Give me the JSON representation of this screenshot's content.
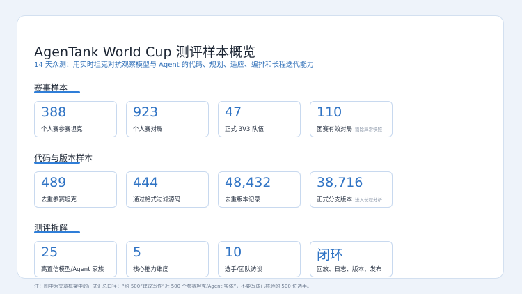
{
  "title": "AgenTank World Cup 测评样本概览",
  "subtitle": "14 天众测：用实时坦克对抗观察模型与 Agent 的代码、规划、适应、编排和长程迭代能力",
  "sections": [
    {
      "heading": "赛事样本",
      "stats": [
        {
          "value": "388",
          "label": "个人赛参赛坦克",
          "note": ""
        },
        {
          "value": "923",
          "label": "个人赛对局",
          "note": ""
        },
        {
          "value": "47",
          "label": "正式 3V3 队伍",
          "note": ""
        },
        {
          "value": "110",
          "label": "团赛有效对局",
          "note": "剔除异常快照"
        }
      ]
    },
    {
      "heading": "代码与版本样本",
      "stats": [
        {
          "value": "489",
          "label": "去重参赛坦克",
          "note": ""
        },
        {
          "value": "444",
          "label": "通过格式过滤源码",
          "note": ""
        },
        {
          "value": "48,432",
          "label": "去重版本记录",
          "note": ""
        },
        {
          "value": "38,716",
          "label": "正式分支版本",
          "note": "进入长程分析"
        }
      ]
    },
    {
      "heading": "测评拆解",
      "stats": [
        {
          "value": "25",
          "label": "高置信模型/Agent 家族",
          "note": ""
        },
        {
          "value": "5",
          "label": "核心能力维度",
          "note": ""
        },
        {
          "value": "10",
          "label": "选手/团队访谈",
          "note": ""
        },
        {
          "value": "闭环",
          "label": "回放、日志、版本、发布",
          "note": ""
        }
      ]
    }
  ],
  "footnote": "注：图中为文章框架中的正式汇总口径；“约 500”建议写作“近 500 个参赛坦克/Agent 实体”，不要写成已核验的 500 位选手。",
  "colors": {
    "accent": "#2f7ed8",
    "value": "#2f73c4",
    "border": "#c8d9ef"
  }
}
